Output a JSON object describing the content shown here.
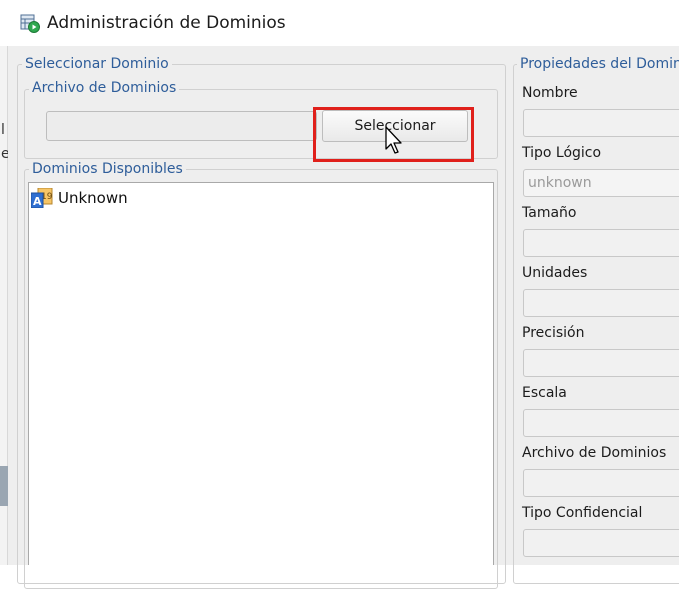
{
  "window": {
    "title": "Administración de Dominios",
    "icon": "table-run-icon"
  },
  "select_domain_panel": {
    "legend": "Seleccionar Dominio",
    "file_group": {
      "legend": "Archivo de Dominios",
      "file_path_value": "",
      "select_button_label": "Seleccionar",
      "highlight_color": "#e0201b"
    },
    "available_group": {
      "legend": "Dominios Disponibles",
      "items": [
        {
          "label": "Unknown",
          "icon": "domain-type-icon"
        }
      ]
    }
  },
  "properties_panel": {
    "legend": "Propiedades del Domin",
    "fields": [
      {
        "label": "Nombre",
        "value": ""
      },
      {
        "label": "Tipo Lógico",
        "value": "unknown"
      },
      {
        "label": "Tamaño",
        "value": ""
      },
      {
        "label": "Unidades",
        "value": ""
      },
      {
        "label": "Precisión",
        "value": ""
      },
      {
        "label": "Escala",
        "value": ""
      },
      {
        "label": "Archivo de Dominios",
        "value": ""
      },
      {
        "label": "Tipo Confidencial",
        "value": ""
      }
    ]
  },
  "background_window": {
    "glyphs": [
      "l",
      "e"
    ]
  },
  "colors": {
    "legend_text": "#2e5d9a",
    "client_background": "#eeeeee"
  }
}
